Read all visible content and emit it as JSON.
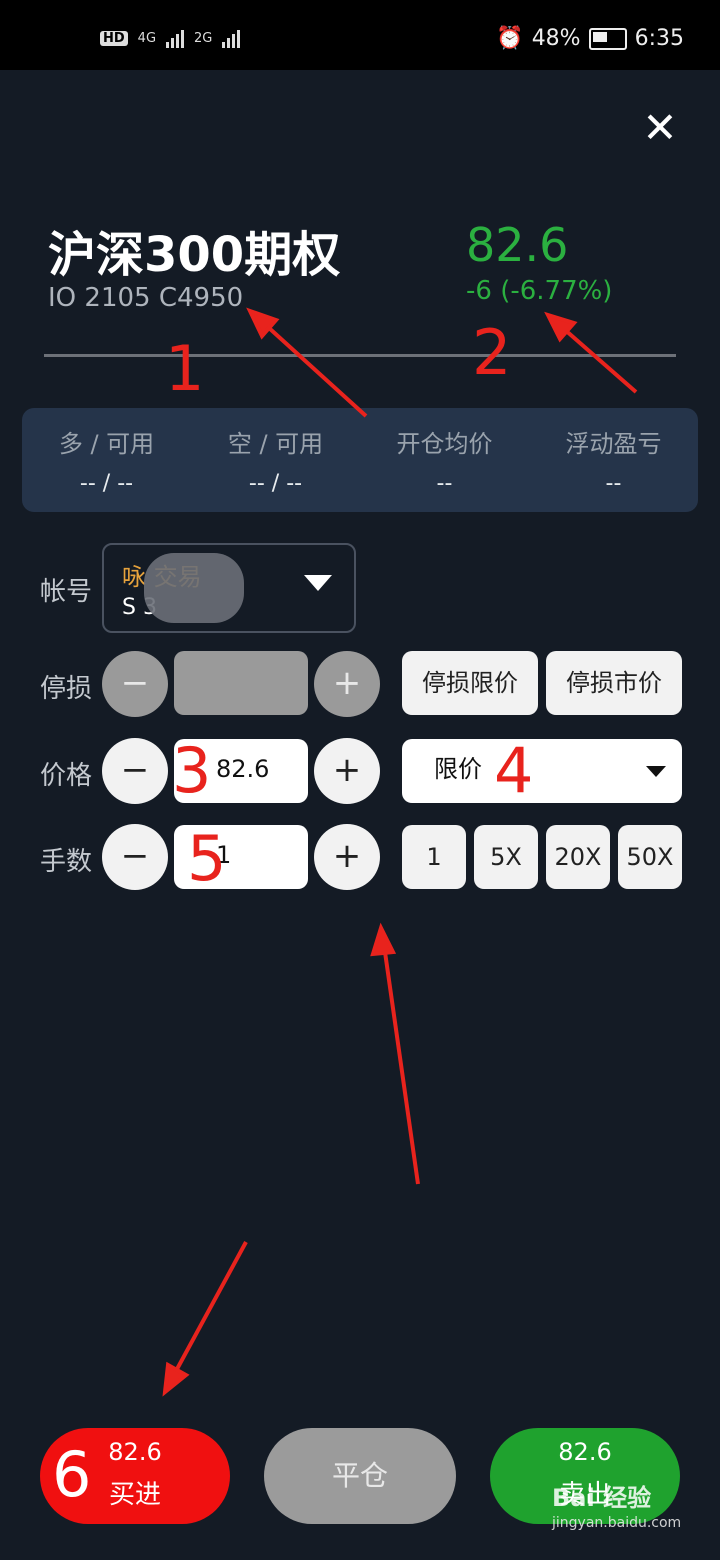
{
  "status": {
    "network1": "4G",
    "network2": "2G",
    "battery": "48%",
    "time": "6:35"
  },
  "header": {
    "title": "沪深300期权",
    "code": "IO 2105 C4950",
    "price": "82.6",
    "change": "-6 (-6.77%)",
    "price_color": "#2bb040"
  },
  "stats": [
    {
      "label": "多 / 可用",
      "value": "-- / --"
    },
    {
      "label": "空 / 可用",
      "value": "-- / --"
    },
    {
      "label": "开仓均价",
      "value": "--"
    },
    {
      "label": "浮动盈亏",
      "value": "--"
    }
  ],
  "form": {
    "account_label": "帐号",
    "account_name": "咏      交易",
    "account_number": "S      3",
    "stoploss_label": "停损",
    "price_label": "价格",
    "qty_label": "手数",
    "minus": "−",
    "plus": "+",
    "price_value": "82.6",
    "qty_value": "1",
    "stop_limit": "停损限价",
    "stop_market": "停损市价",
    "order_type": "限价",
    "multipliers": [
      "1",
      "5X",
      "20X",
      "50X"
    ]
  },
  "annotations": [
    "1",
    "2",
    "3",
    "4",
    "5",
    "6"
  ],
  "actions": {
    "buy_price": "82.6",
    "buy_label": "买进",
    "close_label": "平仓",
    "sell_price": "82.6",
    "sell_label": "卖出",
    "buy_color": "#f01010",
    "sell_color": "#1fa22e"
  },
  "watermark": {
    "brand": "Bai 经验",
    "url": "jingyan.baidu.com"
  }
}
